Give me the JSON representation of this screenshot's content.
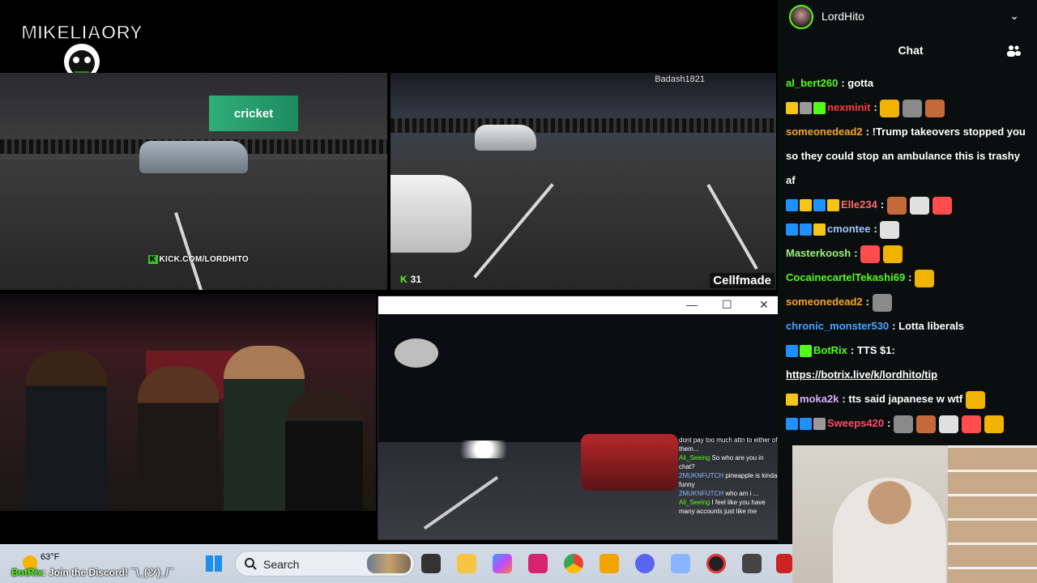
{
  "stream": {
    "logo_text": "MIKELIAORY",
    "panel1": {
      "store_sign": "cricket",
      "watermark": "KICK.COM/LORDHITO",
      "watermark_k": "K"
    },
    "panel2": {
      "viewer_count": "31",
      "viewer_k": "K",
      "streamer_tag": "Cellfmade",
      "top_tag": "Badash1821"
    },
    "panel4": {
      "window_buttons": [
        "—",
        "☐",
        "✕"
      ],
      "mini_chat": [
        {
          "user": "",
          "text": "dont pay too much attn to either of them..."
        },
        {
          "user": "Ali_Seeing",
          "text": "So who are you in chat?"
        },
        {
          "user": "2MUKNFUTCH",
          "text": "pineapple is kinda funny"
        },
        {
          "user": "2MUKNFUTCH",
          "text": "who am i ..."
        },
        {
          "user": "Ali_Seeing",
          "text": "I feel like you have many accounts just like me"
        }
      ]
    }
  },
  "chat": {
    "current_user": "LordHito",
    "title": "Chat",
    "messages": [
      {
        "user": "al_bert260",
        "color": "#53fc18",
        "badges": [],
        "text": "gotta",
        "emotes": 0
      },
      {
        "user": "nexminit",
        "color": "#ff3b3b",
        "badges": [
          "#f5c518",
          "#9a9a9a",
          "#53fc18"
        ],
        "text": "",
        "emotes": 3
      },
      {
        "user": "someonedead2",
        "color": "#f5a623",
        "badges": [],
        "text": "!Trump takeovers stopped you so they could stop an ambulance this is trashy af",
        "emotes": 0
      },
      {
        "user": "Elle234",
        "color": "#ff6a6a",
        "badges": [
          "#1e90ff",
          "#f5c518",
          "#1e90ff",
          "#f5c518"
        ],
        "text": "",
        "emotes": 3
      },
      {
        "user": "cmontee",
        "color": "#9ec7ff",
        "badges": [
          "#1e90ff",
          "#1e90ff",
          "#f5c518"
        ],
        "text": "",
        "emotes": 1
      },
      {
        "user": "Masterkoosh",
        "color": "#9bf27a",
        "badges": [],
        "text": "",
        "emotes": 2
      },
      {
        "user": "CocainecartelTekashi69",
        "color": "#53fc18",
        "badges": [],
        "text": "",
        "emotes": 1
      },
      {
        "user": "someonedead2",
        "color": "#f5a623",
        "badges": [],
        "text": "",
        "emotes": 1
      },
      {
        "user": "chronic_monster530",
        "color": "#4aa3ff",
        "badges": [],
        "text": "Lotta liberals",
        "emotes": 0
      },
      {
        "user": "BotRix",
        "color": "#53fc18",
        "badges": [
          "#1e90ff",
          "#53fc18"
        ],
        "text": "TTS $1:",
        "emotes": 0
      },
      {
        "user": "",
        "color": "#ffffff",
        "badges": [],
        "text": "https://botrix.live/k/lordhito/tip",
        "emotes": 0,
        "link": true
      },
      {
        "user": "moka2k",
        "color": "#d6b0ff",
        "badges": [
          "#f5c518"
        ],
        "text": "tts said japanese w wtf",
        "emotes": 1
      },
      {
        "user": "Sweeps420",
        "color": "#ff4d6d",
        "badges": [
          "#1e90ff",
          "#1e90ff",
          "#9a9a9a"
        ],
        "text": "",
        "emotes": 5
      }
    ]
  },
  "taskbar": {
    "temperature": "63°F",
    "search_label": "Search",
    "discord_bot": "BotRix",
    "discord_text": ": Join the Discord! ¯\\_(ツ)_/¯"
  }
}
